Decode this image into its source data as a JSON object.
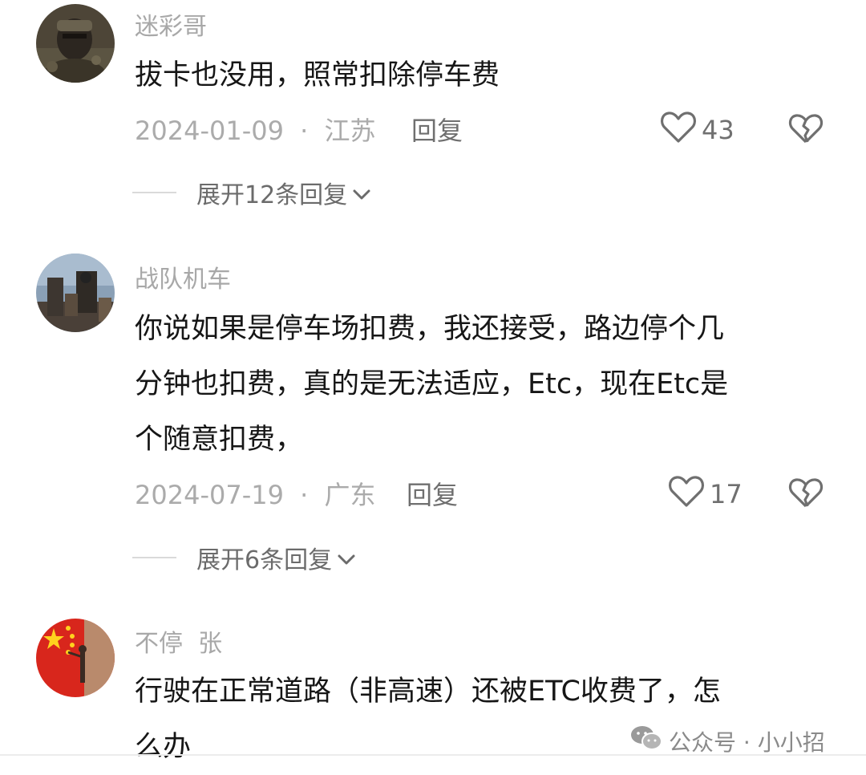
{
  "comments": [
    {
      "username": "迷彩哥",
      "text": "拔卡也没用，照常扣除停车费",
      "date": "2024-01-09",
      "separator": "·",
      "location": "江苏",
      "reply_label": "回复",
      "likes": "43",
      "expand_label": "展开12条回复"
    },
    {
      "username": "战队机车",
      "text": "你说如果是停车场扣费，我还接受，路边停个几\n分钟也扣费，真的是无法适应，Etc，现在Etc是\n个随意扣费，",
      "date": "2024-07-19",
      "separator": "·",
      "location": "广东",
      "reply_label": "回复",
      "likes": "17",
      "expand_label": "展开6条回复"
    },
    {
      "username": "不停  张",
      "text": "行驶在正常道路（非高速）还被ETC收费了，怎\n么办"
    }
  ],
  "watermark": {
    "text": "公众号 · 小小招",
    "icon": "wechat-icon"
  },
  "icons": {
    "like": "heart-outline-icon",
    "dislike": "broken-heart-icon",
    "expand": "chevron-down-icon"
  },
  "colors": {
    "username": "#a8a8a8",
    "meta": "#ababab",
    "body_text": "#161616"
  }
}
